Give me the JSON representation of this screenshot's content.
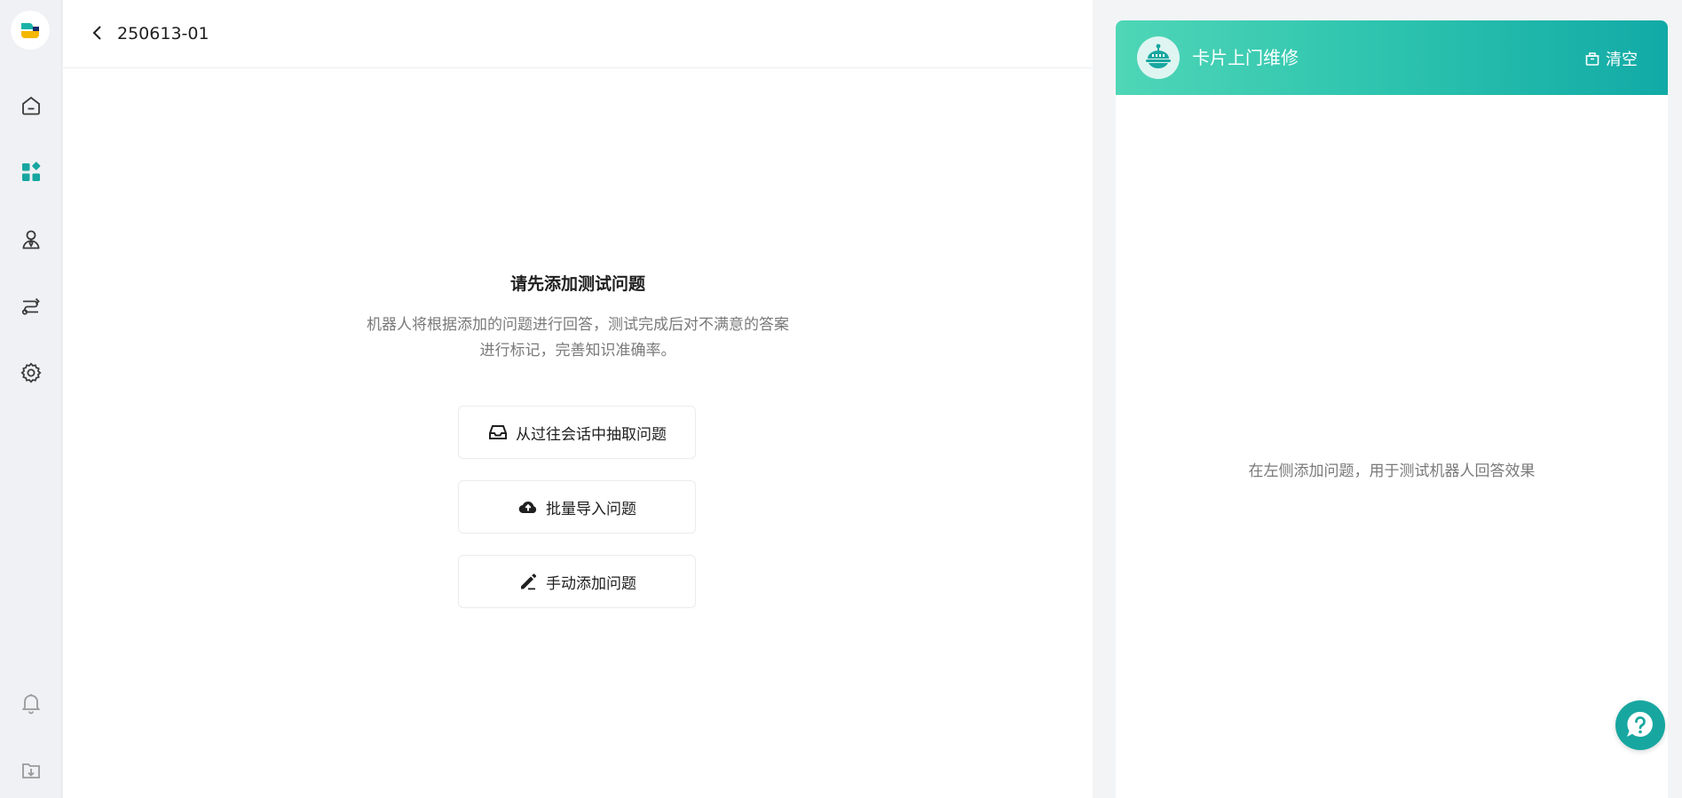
{
  "colors": {
    "accent": "#17a7a0",
    "header_gradient_start": "#4fd6b7",
    "header_gradient_end": "#12aaa6",
    "text_primary": "#1f1f1f",
    "text_secondary": "#7a7a7a"
  },
  "sidebar": {
    "items": [
      {
        "icon": "home-icon"
      },
      {
        "icon": "apps-icon"
      },
      {
        "icon": "user-tie-icon"
      },
      {
        "icon": "route-icon"
      },
      {
        "icon": "gear-icon"
      }
    ],
    "bottom_items": [
      {
        "icon": "bell-icon"
      },
      {
        "icon": "download-icon"
      }
    ]
  },
  "header": {
    "title": "250613-01"
  },
  "empty_state": {
    "title": "请先添加测试问题",
    "description_line1": "机器人将根据添加的问题进行回答，测试完成后对不满意的答案",
    "description_line2": "进行标记，完善知识准确率。"
  },
  "actions": [
    {
      "label": "从过往会话中抽取问题",
      "icon": "inbox-icon"
    },
    {
      "label": "批量导入问题",
      "icon": "cloud-upload-icon"
    },
    {
      "label": "手动添加问题",
      "icon": "pen-icon"
    }
  ],
  "chat": {
    "title": "卡片上门维修",
    "clear_label": "清空",
    "empty_text": "在左侧添加问题，用于测试机器人回答效果"
  }
}
